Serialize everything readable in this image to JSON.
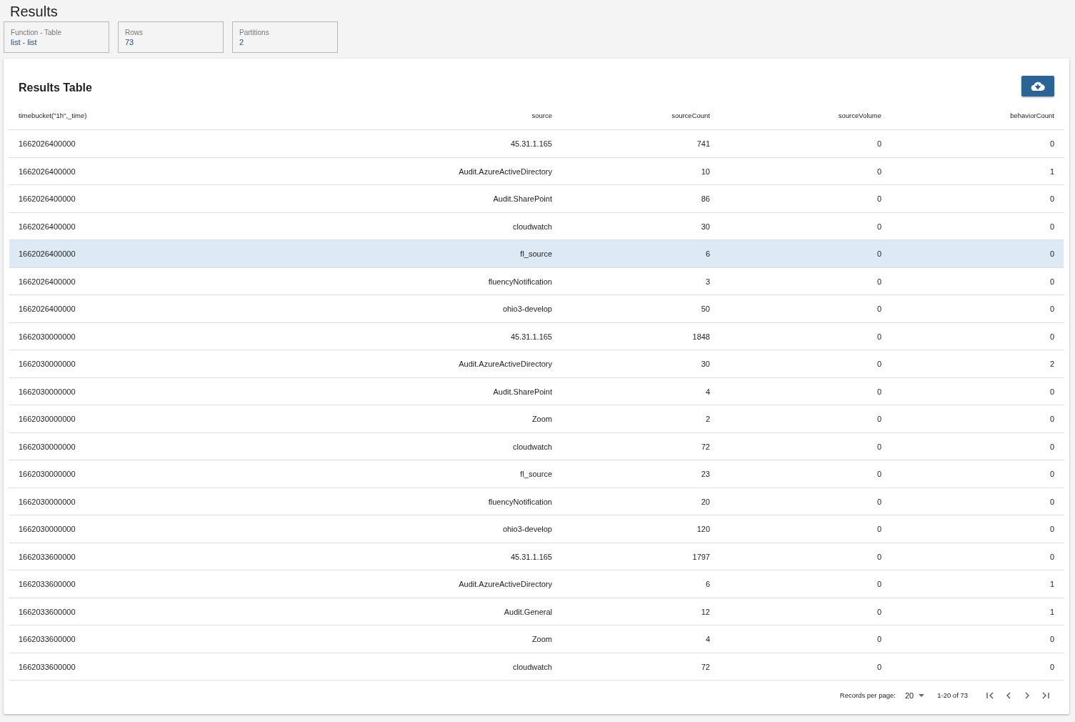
{
  "page_title": "Results",
  "info_cards": [
    {
      "label": "Function - Table",
      "value": "list - list"
    },
    {
      "label": "Rows",
      "value": "73"
    },
    {
      "label": "Partitions",
      "value": "2"
    }
  ],
  "results_table": {
    "title": "Results Table",
    "columns": [
      "timebucket(\"1h\",_time)",
      "source",
      "sourceCount",
      "sourceVolume",
      "behaviorCount"
    ],
    "rows": [
      {
        "cells": [
          "1662026400000",
          "45.31.1.165",
          "741",
          "0",
          "0"
        ],
        "selected": false
      },
      {
        "cells": [
          "1662026400000",
          "Audit.AzureActiveDirectory",
          "10",
          "0",
          "1"
        ],
        "selected": false
      },
      {
        "cells": [
          "1662026400000",
          "Audit.SharePoint",
          "86",
          "0",
          "0"
        ],
        "selected": false
      },
      {
        "cells": [
          "1662026400000",
          "cloudwatch",
          "30",
          "0",
          "0"
        ],
        "selected": false
      },
      {
        "cells": [
          "1662026400000",
          "fl_source",
          "6",
          "0",
          "0"
        ],
        "selected": true
      },
      {
        "cells": [
          "1662026400000",
          "fluencyNotification",
          "3",
          "0",
          "0"
        ],
        "selected": false
      },
      {
        "cells": [
          "1662026400000",
          "ohio3-develop",
          "50",
          "0",
          "0"
        ],
        "selected": false
      },
      {
        "cells": [
          "1662030000000",
          "45.31.1.165",
          "1848",
          "0",
          "0"
        ],
        "selected": false
      },
      {
        "cells": [
          "1662030000000",
          "Audit.AzureActiveDirectory",
          "30",
          "0",
          "2"
        ],
        "selected": false
      },
      {
        "cells": [
          "1662030000000",
          "Audit.SharePoint",
          "4",
          "0",
          "0"
        ],
        "selected": false
      },
      {
        "cells": [
          "1662030000000",
          "Zoom",
          "2",
          "0",
          "0"
        ],
        "selected": false
      },
      {
        "cells": [
          "1662030000000",
          "cloudwatch",
          "72",
          "0",
          "0"
        ],
        "selected": false
      },
      {
        "cells": [
          "1662030000000",
          "fl_source",
          "23",
          "0",
          "0"
        ],
        "selected": false
      },
      {
        "cells": [
          "1662030000000",
          "fluencyNotification",
          "20",
          "0",
          "0"
        ],
        "selected": false
      },
      {
        "cells": [
          "1662030000000",
          "ohio3-develop",
          "120",
          "0",
          "0"
        ],
        "selected": false
      },
      {
        "cells": [
          "1662033600000",
          "45.31.1.165",
          "1797",
          "0",
          "0"
        ],
        "selected": false
      },
      {
        "cells": [
          "1662033600000",
          "Audit.AzureActiveDirectory",
          "6",
          "0",
          "1"
        ],
        "selected": false
      },
      {
        "cells": [
          "1662033600000",
          "Audit.General",
          "12",
          "0",
          "1"
        ],
        "selected": false
      },
      {
        "cells": [
          "1662033600000",
          "Zoom",
          "4",
          "0",
          "0"
        ],
        "selected": false
      },
      {
        "cells": [
          "1662033600000",
          "cloudwatch",
          "72",
          "0",
          "0"
        ],
        "selected": false
      }
    ]
  },
  "pagination": {
    "records_label": "Records per page:",
    "per_page": "20",
    "range": "1-20 of 73"
  }
}
